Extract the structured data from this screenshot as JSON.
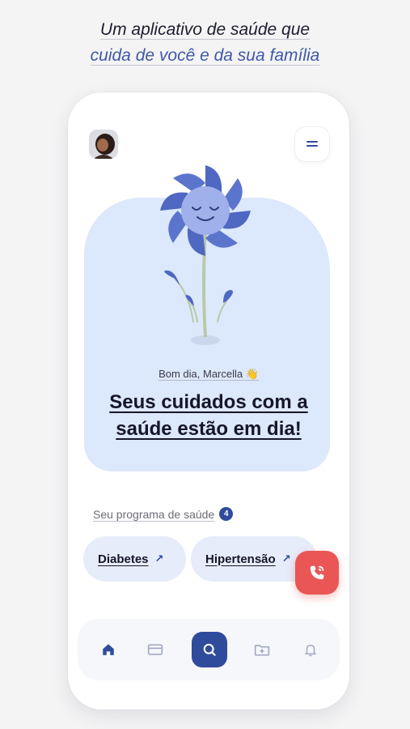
{
  "promo": {
    "line1": "Um aplicativo de saúde  que",
    "line2": "cuida de você e da sua família"
  },
  "hero": {
    "greeting": "Bom dia, Marcella 👋",
    "headline_line1": "Seus cuidados com a",
    "headline_line2": "saúde estão em dia!"
  },
  "program": {
    "label": "Seu programa de saúde",
    "count": "4",
    "items": [
      {
        "label": "Diabetes",
        "icon": "arrow-up-right-icon"
      },
      {
        "label": "Hipertensão",
        "icon": "arrow-up-right-icon"
      }
    ]
  },
  "nav": {
    "items": [
      "home-icon",
      "card-icon",
      "search-icon",
      "folder-plus-icon",
      "bell-icon"
    ]
  },
  "colors": {
    "accent": "#2f4b9c",
    "hero_bg": "#dce8fb",
    "pill_bg": "#e6ecfa",
    "call": "#ea5656"
  }
}
